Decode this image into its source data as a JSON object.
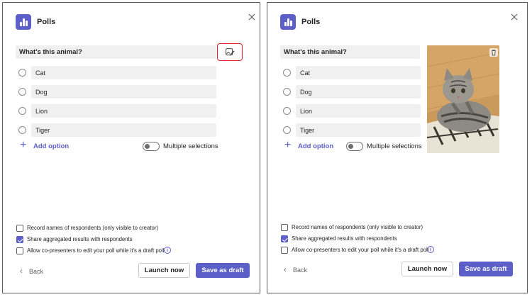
{
  "app": {
    "title": "Polls"
  },
  "poll": {
    "question": "What's this animal?",
    "options": [
      "Cat",
      "Dog",
      "Lion",
      "Tiger"
    ],
    "add_option_label": "Add option",
    "multiple_selections_label": "Multiple selections",
    "multiple_selections_on": false
  },
  "settings": {
    "record_names": {
      "label": "Record names of respondents (only visible to creator)",
      "checked": false
    },
    "share_results": {
      "label": "Share aggregated results with respondents",
      "checked": true
    },
    "allow_copresenters": {
      "label": "Allow co-presenters to edit your poll while it's a draft poll",
      "checked": false
    }
  },
  "footer": {
    "back_label": "Back",
    "launch_label": "Launch now",
    "draft_label": "Save as draft"
  },
  "icons": {
    "app": "poll-chart-icon",
    "close": "close-icon",
    "edit": "image-edit-icon",
    "delete": "trash-icon",
    "info": "info-icon",
    "back": "chevron-left-icon",
    "add": "plus-icon"
  },
  "colors": {
    "accent": "#5b5fc7",
    "highlight": "#e0242b",
    "field": "#f0f0f0"
  }
}
